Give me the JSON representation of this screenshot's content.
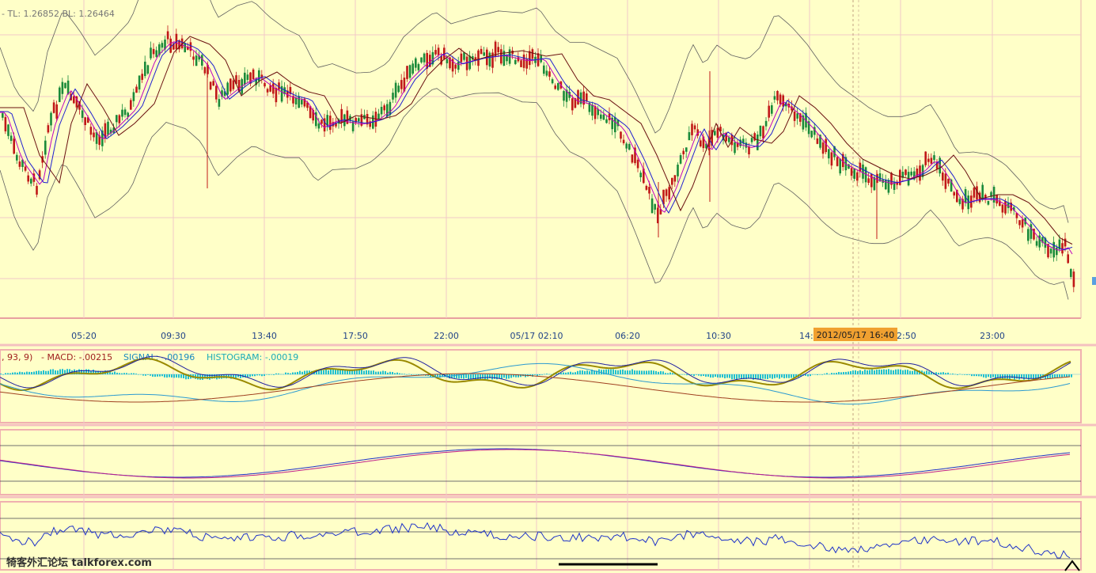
{
  "colors": {
    "background": "#ffffc8",
    "grid": "#f2c8c8",
    "up_candle": "#1a8a3a",
    "down_candle": "#c01818",
    "bollinger": "#606060",
    "ma_fast": "#c000c0",
    "ma_mid": "#2020d0",
    "ma_slow": "#6a1010",
    "macd_line": "#9a8a00",
    "signal_line": "#2a9ad0",
    "histogram": "#20c0d0",
    "osc_blue": "#1f33c8",
    "osc_pink": "#c0208a",
    "highlight_box": "#f0a030"
  },
  "price_panel": {
    "header": "-  TL: 1.26852  BL: 1.26464",
    "time_labels": [
      "05:20",
      "09:30",
      "13:40",
      "17:50",
      "22:00",
      "05/17 02:10",
      "06:20",
      "10:30",
      "14:",
      "2:50",
      "23:00"
    ],
    "crosshair_time": "2012/05/17 16:40"
  },
  "macd_panel": {
    "params": ", 93, 9)",
    "macd": "- MACD: -.00215",
    "signal": "SIGNAL: -.00196",
    "histogram": "HISTOGRAM: -.00019"
  },
  "watermark": "犄客外汇论坛 talkforex.com",
  "chart_data": {
    "type": "line",
    "title": "",
    "series": [
      {
        "name": "TL",
        "values": [
          1.26852
        ]
      },
      {
        "name": "BL",
        "values": [
          1.26464
        ]
      }
    ],
    "x": [
      "05:20",
      "09:30",
      "13:40",
      "17:50",
      "22:00",
      "05/17 02:10",
      "06:20",
      "10:30",
      "14:",
      "2:50",
      "23:00"
    ],
    "indicators": {
      "macd": -0.00215,
      "signal": -0.00196,
      "histogram": -0.00019
    },
    "panels": [
      "price",
      "macd",
      "oscillator",
      "oscillator"
    ],
    "grid": true
  }
}
